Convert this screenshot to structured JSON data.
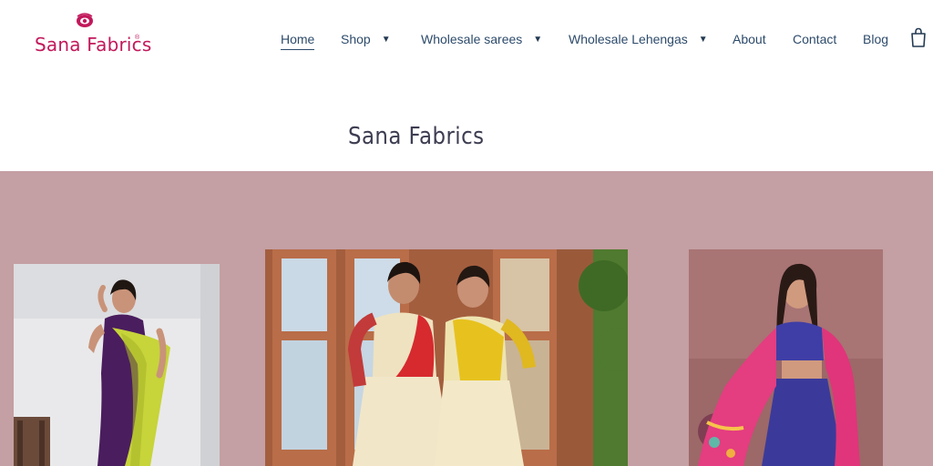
{
  "brand": {
    "name": "Sana Fabrics",
    "reg_mark": "®",
    "accent_color": "#c2185b"
  },
  "nav": {
    "items": [
      {
        "label": "Home",
        "active": true
      },
      {
        "label": "Shop",
        "caret": "▼"
      },
      {
        "label": "Wholesale sarees",
        "caret": "▼"
      },
      {
        "label": "Wholesale Lehengas",
        "caret": "▼"
      },
      {
        "label": "About"
      },
      {
        "label": "Contact"
      },
      {
        "label": "Blog"
      }
    ],
    "cart_icon": "shopping-bag-icon",
    "text_color": "#2d4b6b"
  },
  "hero": {
    "title": "Sana Fabrics"
  },
  "gallery": {
    "background": "#c49fa3",
    "photos": [
      {
        "subject": "model-in-purple-and-lime-saree"
      },
      {
        "subject": "two-models-in-red-and-yellow-lehengas"
      },
      {
        "subject": "model-in-blue-lehenga-with-pink-dupatta"
      }
    ]
  }
}
